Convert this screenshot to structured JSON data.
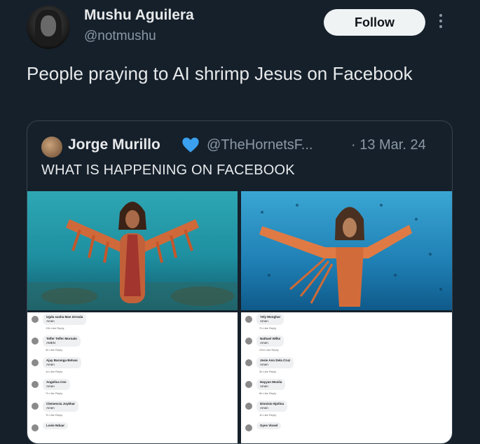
{
  "author": {
    "name": "Mushu Aguilera",
    "handle": "@notmushu",
    "follow_label": "Follow"
  },
  "tweet": {
    "text": "People praying to AI shrimp Jesus on Facebook"
  },
  "quote": {
    "name": "Jorge Murillo",
    "handle": "@TheHornetsF...",
    "date": "· 13 Mar. 24",
    "text": "WHAT IS HAPPENING ON FACEBOOK",
    "verified_color": "#1d9bf0"
  },
  "comments_left": [
    {
      "name": "Ugda sasha Mae Zervala",
      "text": "Amen",
      "meta": "13h  Like  Reply"
    },
    {
      "name": "Telfer Telfer Mornalo",
      "text": "AMEN",
      "meta": "4h  Like  Reply"
    },
    {
      "name": "Ajay Barunga Belvas",
      "text": "Amen",
      "meta": "1d  Like  Reply"
    },
    {
      "name": "Angelica Cen",
      "text": "Amen",
      "meta": "7h  Like  Reply"
    },
    {
      "name": "Clemencia Joykhar",
      "text": "Amen",
      "meta": "7h  Like  Reply"
    },
    {
      "name": "Lovie Nduar",
      "text": "",
      "meta": ""
    }
  ],
  "comments_right": [
    {
      "name": "Yely Monghar",
      "text": "Amen",
      "meta": "7h  Like  Reply"
    },
    {
      "name": "Nathael Wilks",
      "text": "Amen",
      "meta": "23m  Like  Reply"
    },
    {
      "name": "Jesie Ann Dela Cruz",
      "text": "Amen",
      "meta": "3h  Like  Reply"
    },
    {
      "name": "Hayyan Mosila",
      "text": "Amen",
      "meta": "6h  Like  Reply"
    },
    {
      "name": "Dionisio Njolina",
      "text": "Amen",
      "meta": "1h  Like  Reply"
    },
    {
      "name": "Gyes Vinsel",
      "text": "",
      "meta": ""
    }
  ]
}
